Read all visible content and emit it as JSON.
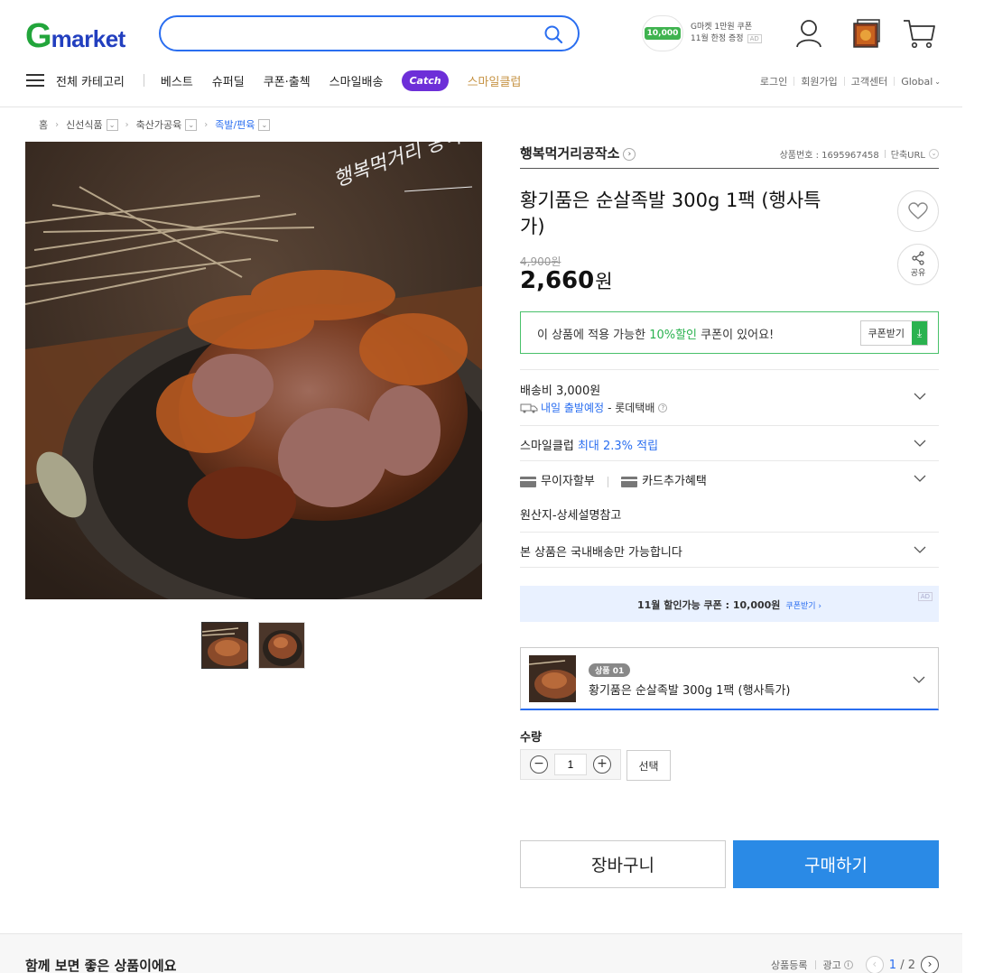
{
  "header": {
    "logo_g": "G",
    "logo_rest": "market",
    "search": {
      "placeholder": "",
      "value": ""
    },
    "coupon_promo": {
      "amount": "10,000",
      "line1": "G마켓 1만원 쿠폰",
      "line2": "11월 한정 증정",
      "ad": "AD"
    }
  },
  "nav": {
    "all_categories": "전체 카테고리",
    "items": [
      "베스트",
      "슈퍼딜",
      "쿠폰·출첵",
      "스마일배송"
    ],
    "catch": "Catch",
    "smileclub": "스마일클럽",
    "util": [
      "로그인",
      "회원가입",
      "고객센터",
      "Global"
    ]
  },
  "breadcrumb": [
    "홈",
    "신선식품",
    "축산가공육",
    "족발/편육"
  ],
  "product": {
    "seller": "행복먹거리공작소",
    "product_no_label": "상품번호 : 1695967458",
    "short_url": "단축URL",
    "title": "황기품은 순살족발 300g 1팩 (행사특가)",
    "original_price": "4,900원",
    "price": "2,660",
    "price_unit": "원",
    "share_label": "공유",
    "image_overlay_text": "행복먹거리 공작소"
  },
  "coupon_box": {
    "pre": "이 상품에 적용 가능한",
    "highlight": "10%할인",
    "post": "쿠폰이 있어요!",
    "button": "쿠폰받기"
  },
  "shipping": {
    "fee": "배송비 3,000원",
    "schedule": "내일 출발예정",
    "carrier": "- 롯데택배"
  },
  "smileclub_row": {
    "label": "스마일클럽",
    "benefit": "최대 2.3% 적립"
  },
  "payment_row": {
    "installment": "무이자할부",
    "card_benefit": "카드추가혜택"
  },
  "origin_row": "원산지-상세설명참고",
  "domestic_row": "본 상품은 국내배송만 가능합니다",
  "ad_banner": {
    "text": "11월 할인가능 쿠폰 : 10,000원",
    "link": "쿠폰받기 ›",
    "ad": "AD"
  },
  "option": {
    "badge": "상품 01",
    "name": "황기품은 순살족발 300g 1팩 (행사특가)"
  },
  "quantity": {
    "label": "수량",
    "value": "1",
    "select": "선택"
  },
  "actions": {
    "cart": "장바구니",
    "buy": "구매하기"
  },
  "bottom": {
    "heading": "함께 보면 좋은 상품이에요",
    "register": "상품등록",
    "ad": "광고",
    "page_current": "1",
    "page_total": "/ 2"
  },
  "colors": {
    "brand_green": "#22a53b",
    "brand_blue": "#223fbf",
    "accent": "#2a8ae6",
    "coupon_green": "#2ab24f"
  }
}
